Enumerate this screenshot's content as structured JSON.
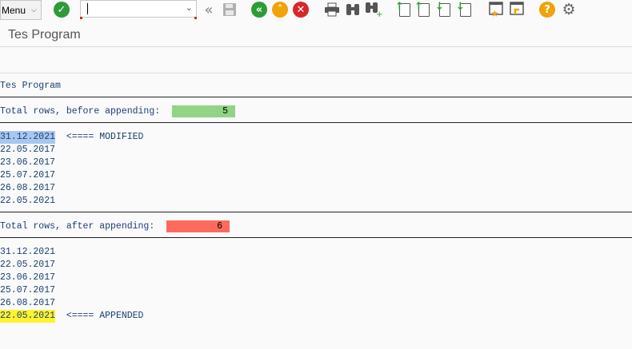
{
  "toolbar": {
    "menu_label": "Menu",
    "command_value": "",
    "icons": [
      "enter-icon",
      "back-nav-icon",
      "save-icon",
      "back-icon",
      "exit-icon",
      "cancel-icon",
      "print-icon",
      "find-icon",
      "find-next-icon",
      "first-page-icon",
      "previous-page-icon",
      "next-page-icon",
      "last-page-icon",
      "create-session-icon",
      "shortcut-icon",
      "help-icon",
      "settings-icon"
    ]
  },
  "title": "Tes Program",
  "list": {
    "heading": "Tes Program",
    "before_label": "Total rows, before appending:",
    "before_count": "5",
    "before_color": "#92d386",
    "rows_before": [
      {
        "date": "31.12.2021",
        "note": "<==== MODIFIED",
        "highlight": "#a6c8f0"
      },
      {
        "date": "22.05.2017",
        "note": ""
      },
      {
        "date": "23.06.2017",
        "note": ""
      },
      {
        "date": "25.07.2017",
        "note": ""
      },
      {
        "date": "26.08.2017",
        "note": ""
      },
      {
        "date": "22.05.2021",
        "note": ""
      }
    ],
    "after_label": "Total rows, after appending:",
    "after_count": "6",
    "after_color": "#ff6a5e",
    "rows_after": [
      {
        "date": "31.12.2021",
        "note": ""
      },
      {
        "date": "22.05.2017",
        "note": ""
      },
      {
        "date": "23.06.2017",
        "note": ""
      },
      {
        "date": "25.07.2017",
        "note": ""
      },
      {
        "date": "26.08.2017",
        "note": ""
      },
      {
        "date": "22.05.2021",
        "note": "<==== APPENDED",
        "highlight": "#fdf32f"
      }
    ]
  }
}
